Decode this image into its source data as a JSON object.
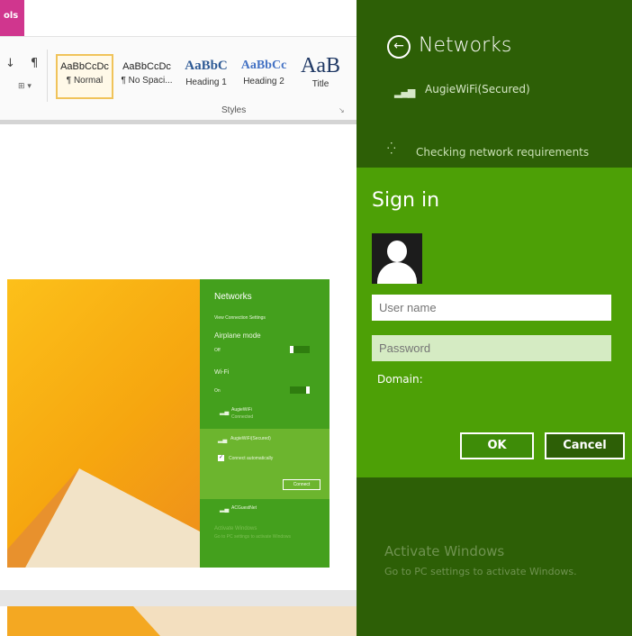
{
  "word": {
    "tools_tab": "ols",
    "ribbon_glyphs": {
      "sort": "↓",
      "pilcrow": "¶",
      "borders": "⊞ ▾"
    },
    "styles": [
      {
        "sample": "AaBbCcDc",
        "label": "¶ Normal",
        "selected": true
      },
      {
        "sample": "AaBbCcDc",
        "label": "¶ No Spaci..."
      },
      {
        "sample": "AaBbC",
        "label": "Heading 1"
      },
      {
        "sample": "AaBbCc",
        "label": "Heading 2"
      },
      {
        "sample": "AaB",
        "label": "Title"
      }
    ],
    "group_label": "Styles",
    "launcher_glyph": "↘"
  },
  "screenshot": {
    "title": "Networks",
    "view_settings": "View Connection Settings",
    "airplane": {
      "label": "Airplane mode",
      "state": "Off"
    },
    "wifi": {
      "label": "Wi-Fi",
      "state": "On"
    },
    "networks": [
      {
        "name": "AugieWiFi",
        "status": "Connected"
      },
      {
        "name": "AugieWiFi(Secured)",
        "status": ""
      },
      {
        "name": "ACGuestNet",
        "status": ""
      }
    ],
    "connect_auto": "Connect automatically",
    "connect_button": "Connect",
    "activate_title": "Activate Windows",
    "activate_sub": "Go to PC settings to activate Windows"
  },
  "charm": {
    "back_glyph": "←",
    "title": "Networks",
    "network_name": "AugieWiFi(Secured)",
    "signal_glyph": "▂▄▆",
    "checking": "Checking network requirements",
    "spinner_glyph": "⁛",
    "signin": {
      "title": "Sign in",
      "username_placeholder": "User name",
      "password_placeholder": "Password",
      "domain_label": "Domain:",
      "ok": "OK",
      "cancel": "Cancel"
    },
    "activate_title": "Activate Windows",
    "activate_sub": "Go to PC settings to activate Windows."
  },
  "colors": {
    "charm_dark": "#2d5f06",
    "signin_green": "#4da006",
    "tools_tab": "#d0368e"
  }
}
